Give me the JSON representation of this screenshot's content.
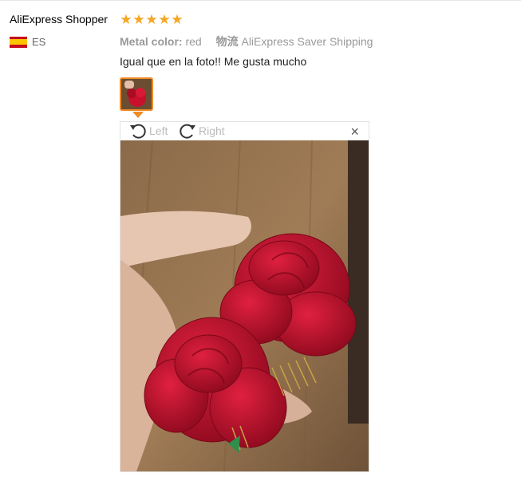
{
  "reviewer": {
    "name": "AliExpress Shopper",
    "country_code": "ES",
    "flag_icon": "spain-flag-icon",
    "rating": 5
  },
  "attributes": {
    "color_key": "Metal color:",
    "color_value": "red",
    "shipping_key": "物流",
    "shipping_value": "AliExpress Saver Shipping"
  },
  "review": {
    "text": "Igual que en la foto!! Me gusta mucho"
  },
  "viewer": {
    "rotate_left_label": "Left",
    "rotate_right_label": "Right",
    "close_glyph": "×"
  },
  "colors": {
    "star": "#f5a623",
    "accent": "#f08a24",
    "rose": "#c8102e"
  }
}
